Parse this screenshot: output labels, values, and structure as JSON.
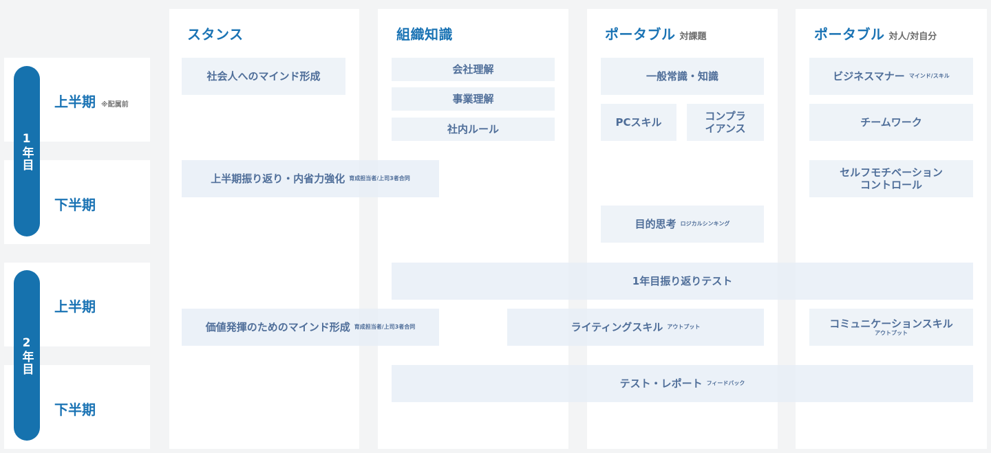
{
  "columns": {
    "stance": {
      "title": "スタンス",
      "sub": ""
    },
    "org": {
      "title": "組織知識",
      "sub": ""
    },
    "portable_task": {
      "title": "ポータブル",
      "sub": "対課題"
    },
    "portable_people": {
      "title": "ポータブル",
      "sub": "対人/対自分"
    }
  },
  "years": {
    "y1": "1年目",
    "y2": "2年目"
  },
  "rows": {
    "y1_first": {
      "label": "上半期",
      "note": "※配属前"
    },
    "y1_second": {
      "label": "下半期"
    },
    "y2_first": {
      "label": "上半期"
    },
    "y2_second": {
      "label": "下半期"
    }
  },
  "items": {
    "mind_social": {
      "text": "社会人へのマインド形成"
    },
    "review_first": {
      "text": "上半期振り返り・内省力強化",
      "note": "育成担当者/上司3者合同"
    },
    "value_mind": {
      "text": "価値発揮のためのマインド形成",
      "note": "育成担当者/上司3者合同"
    },
    "company": {
      "text": "会社理解"
    },
    "business": {
      "text": "事業理解"
    },
    "rules": {
      "text": "社内ルール"
    },
    "common": {
      "text": "一般常識・知識"
    },
    "pc": {
      "text": "PCスキル"
    },
    "compliance_1": {
      "text": "コンプラ"
    },
    "compliance_2": {
      "text": "イアンス"
    },
    "logical": {
      "text": "目的思考",
      "note": "ロジカルシンキング"
    },
    "manner": {
      "text": "ビジネスマナー",
      "note": "マインド/スキル"
    },
    "teamwork": {
      "text": "チームワーク"
    },
    "selfmot_1": {
      "text": "セルフモチベーション"
    },
    "selfmot_2": {
      "text": "コントロール"
    },
    "test_y1": {
      "text": "1年目振り返りテスト"
    },
    "writing": {
      "text": "ライティングスキル",
      "note": "アウトプット"
    },
    "communication": {
      "text": "コミュニケーションスキル",
      "note": "アウトプット"
    },
    "report": {
      "text": "テスト・レポート",
      "note": "フィードバック"
    }
  }
}
